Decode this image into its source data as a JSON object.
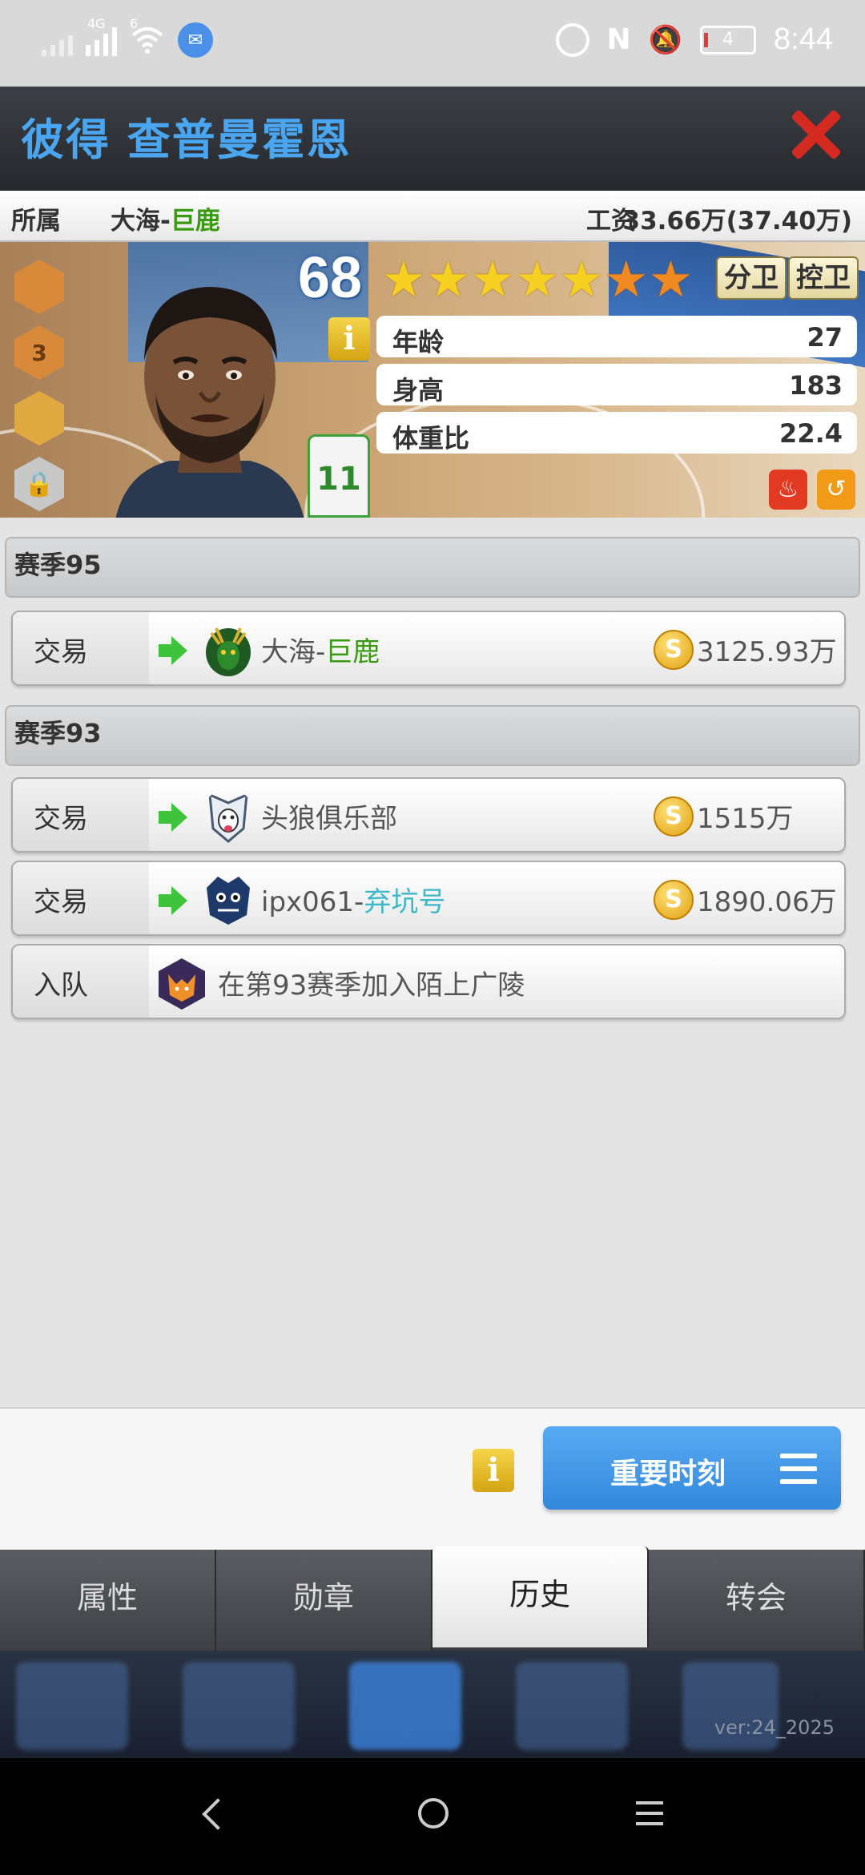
{
  "status_bar": {
    "network_label": "4G",
    "wifi_label": "6",
    "battery": "4",
    "time": "8:44"
  },
  "header": {
    "player_name": "彼得 查普曼霍恩"
  },
  "team_line": {
    "affiliation_label": "所属",
    "team_prefix": "大海-",
    "team_name": "巨鹿",
    "salary_label": "工资",
    "salary_value": "33.66万(37.40万)"
  },
  "player_card": {
    "badges": [
      "",
      "3",
      "",
      ""
    ],
    "rating": "68",
    "stars": {
      "yellow": 5,
      "orange": 2
    },
    "positions": [
      "分卫",
      "控卫"
    ],
    "info_icon": "i",
    "jersey_number": "11",
    "stats": [
      {
        "label": "年龄",
        "value": "27"
      },
      {
        "label": "身高",
        "value": "183"
      },
      {
        "label": "体重比",
        "value": "22.4"
      }
    ]
  },
  "history": {
    "seasons": [
      {
        "title": "赛季95",
        "entries": [
          {
            "type": "交易",
            "team_prefix": "大海-",
            "team_highlight": "巨鹿",
            "highlight_color": "green",
            "price": "3125.93万",
            "coin": "S"
          }
        ]
      },
      {
        "title": "赛季93",
        "entries": [
          {
            "type": "交易",
            "team_prefix": "头狼俱乐部",
            "team_highlight": "",
            "highlight_color": "",
            "price": "1515万",
            "coin": "S"
          },
          {
            "type": "交易",
            "team_prefix": "ipx061-",
            "team_highlight": "弃坑号",
            "highlight_color": "cyan",
            "price": "1890.06万",
            "coin": "S"
          },
          {
            "type": "入队",
            "text": "在第93赛季加入陌上广陵"
          }
        ]
      }
    ]
  },
  "actions": {
    "info_icon": "i",
    "moments_label": "重要时刻"
  },
  "tabs": [
    {
      "label": "属性",
      "active": false
    },
    {
      "label": "勋章",
      "active": false
    },
    {
      "label": "历史",
      "active": true
    },
    {
      "label": "转会",
      "active": false
    }
  ],
  "footer": {
    "version": "ver:24_2025"
  },
  "colors": {
    "header_name": "#4aa6f0",
    "close": "#d42a20",
    "team_green": "#3a9a12",
    "team_cyan": "#3cb8c8",
    "moments_button": "#3f94e4"
  }
}
